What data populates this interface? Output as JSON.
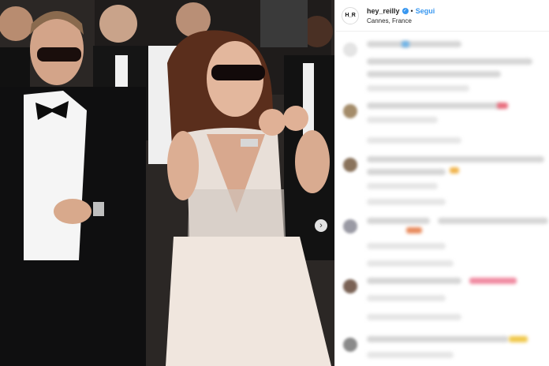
{
  "post": {
    "username": "hey_reilly",
    "location": "Cannes, France",
    "follow_label": "Segui",
    "separator": "•",
    "avatar_text": "H_R"
  },
  "icons": {
    "verified": "verified-badge-icon",
    "next": "chevron-right-icon"
  },
  "colors": {
    "accent": "#3897f0",
    "text": "#262626",
    "border": "#efefef"
  }
}
